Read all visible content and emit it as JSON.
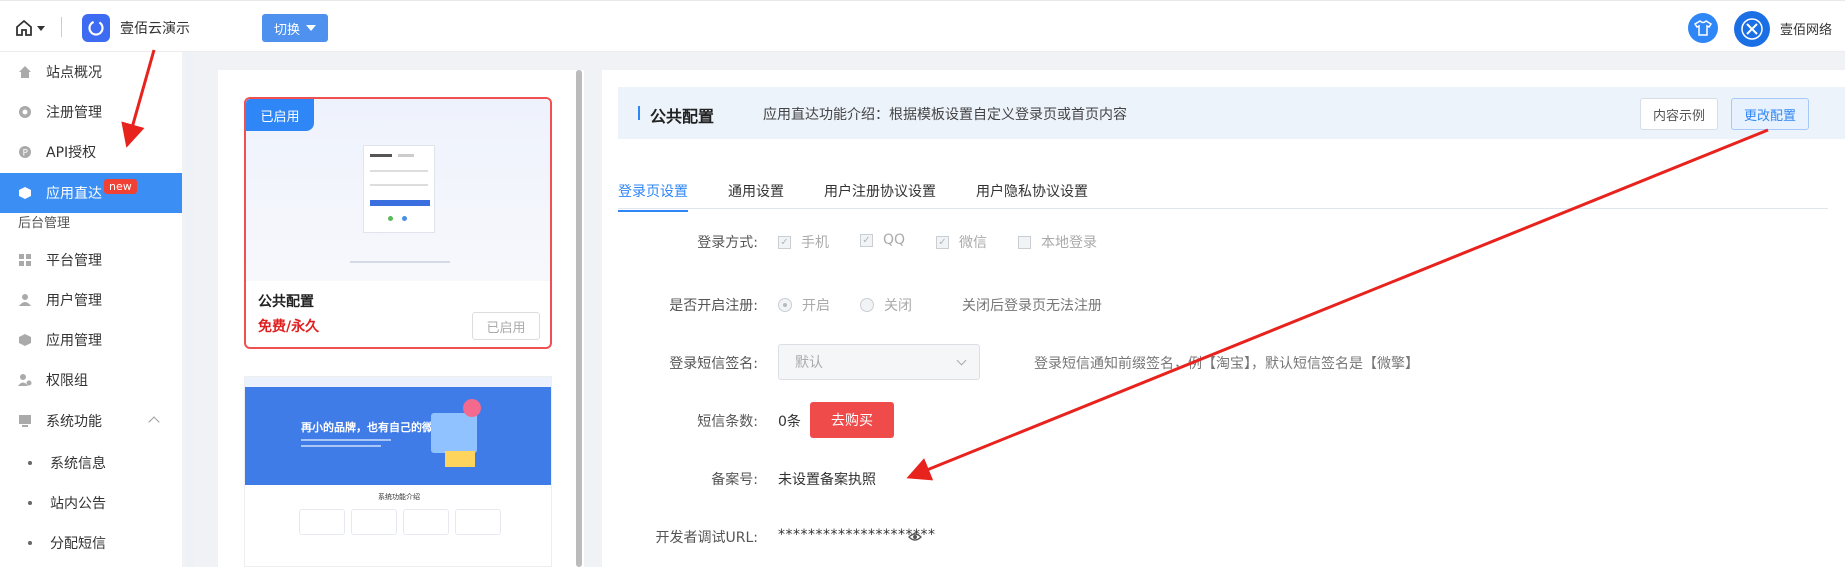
{
  "header": {
    "app_name": "壹佰云演示",
    "switch_label": "切换",
    "user_name": "壹佰网络"
  },
  "sidebar": {
    "items": [
      {
        "label": "站点概况",
        "icon": "home-icon"
      },
      {
        "label": "注册管理",
        "icon": "register-icon"
      },
      {
        "label": "API授权",
        "icon": "api-icon"
      },
      {
        "label": "应用直达",
        "icon": "cube-icon",
        "badge": "new",
        "active": true
      }
    ],
    "section_label": "后台管理",
    "items2": [
      {
        "label": "平台管理",
        "icon": "grid-icon"
      },
      {
        "label": "用户管理",
        "icon": "user-icon"
      },
      {
        "label": "应用管理",
        "icon": "cube-icon"
      },
      {
        "label": "权限组",
        "icon": "permission-icon"
      },
      {
        "label": "系统功能",
        "icon": "monitor-icon"
      }
    ],
    "sub_items": [
      "系统信息",
      "站内公告",
      "分配短信"
    ]
  },
  "templates": {
    "card1": {
      "tag": "已启用",
      "title": "公共配置",
      "price": "免费/永久",
      "button": "已启用"
    },
    "card2": {
      "banner_text": "再小的品牌，也有自己的微擎。",
      "section_title": "系统功能介绍"
    }
  },
  "main": {
    "title": "公共配置",
    "description": "应用直达功能介绍：根据模板设置自定义登录页或首页内容",
    "sample_button": "内容示例",
    "change_button": "更改配置",
    "tabs": [
      "登录页设置",
      "通用设置",
      "用户注册协议设置",
      "用户隐私协议设置"
    ],
    "form": {
      "login_method_label": "登录方式:",
      "login_methods": [
        "手机",
        "QQ",
        "微信",
        "本地登录"
      ],
      "register_label": "是否开启注册:",
      "register_on": "开启",
      "register_off": "关闭",
      "register_hint": "关闭后登录页无法注册",
      "sms_sign_label": "登录短信签名:",
      "sms_sign_value": "默认",
      "sms_sign_hint": "登录短信通知前缀签名，例【淘宝】，默认短信签名是【微擎】",
      "sms_count_label": "短信条数:",
      "sms_count_value": "0条",
      "buy_button": "去购买",
      "icp_label": "备案号:",
      "icp_value": "未设置备案执照",
      "dev_url_label": "开发者调试URL:",
      "dev_url_value": "*********************"
    }
  },
  "colors": {
    "accent": "#2f86f6",
    "danger": "#f04b4b",
    "annotation_arrow": "#e8221c"
  }
}
